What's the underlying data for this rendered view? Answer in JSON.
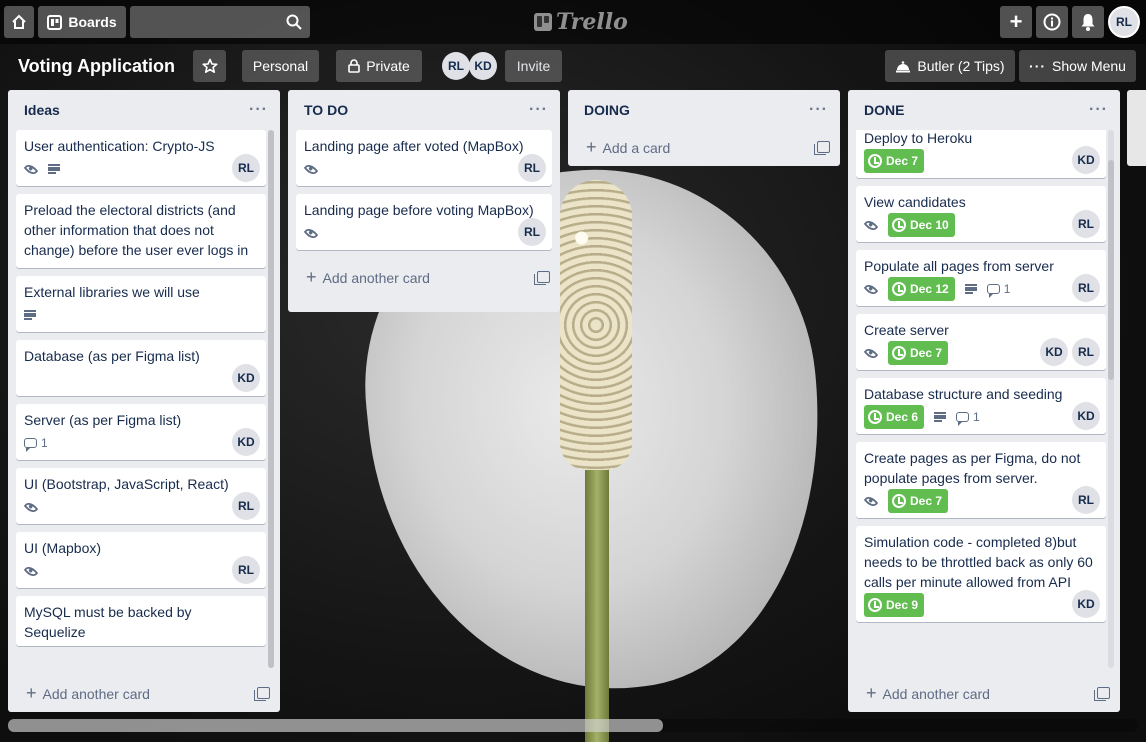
{
  "app": {
    "logo_text": "Trello"
  },
  "topbar": {
    "boards_label": "Boards",
    "search_value": "",
    "user_initials": "RL"
  },
  "board": {
    "title": "Voting Application",
    "team_label": "Personal",
    "visibility_label": "Private",
    "members": [
      "RL",
      "KD"
    ],
    "invite_label": "Invite",
    "butler_label": "Butler (2 Tips)",
    "menu_label": "Show Menu"
  },
  "add_card_label": "Add a card",
  "add_another_label": "Add another card",
  "colors": {
    "due_green": "#61bd4f",
    "list_bg": "#ebecf0"
  },
  "lists": [
    {
      "name": "Ideas",
      "cards": [
        {
          "title": "User authentication: Crypto-JS",
          "watch": true,
          "desc": true,
          "members": [
            "RL"
          ]
        },
        {
          "title": "Preload the electoral districts (and other information that does not change) before the user ever logs in",
          "members": []
        },
        {
          "title": "External libraries we will use",
          "desc": true,
          "members": []
        },
        {
          "title": "Database (as per Figma list)",
          "members": [
            "KD"
          ]
        },
        {
          "title": "Server (as per Figma list)",
          "comments": "1",
          "members": [
            "KD"
          ]
        },
        {
          "title": "UI (Bootstrap, JavaScript, React)",
          "watch": true,
          "members": [
            "RL"
          ]
        },
        {
          "title": "UI (Mapbox)",
          "watch": true,
          "members": [
            "RL"
          ]
        },
        {
          "title": "MySQL must be backed by Sequelize",
          "members": []
        }
      ]
    },
    {
      "name": "TO DO",
      "cards": [
        {
          "title": "Landing page after voted (MapBox)",
          "watch": true,
          "members": [
            "RL"
          ]
        },
        {
          "title": "Landing page before voting MapBox)",
          "watch": true,
          "members": [
            "RL"
          ]
        }
      ]
    },
    {
      "name": "DOING",
      "cards": []
    },
    {
      "name": "DONE",
      "cards": [
        {
          "title": "Deploy to Heroku",
          "due": "Dec 7",
          "members": [
            "KD"
          ]
        },
        {
          "title": "View candidates",
          "watch": true,
          "due": "Dec 10",
          "members": [
            "RL"
          ]
        },
        {
          "title": "Populate all pages from server",
          "watch": true,
          "due": "Dec 12",
          "desc": true,
          "comments": "1",
          "members": [
            "RL"
          ]
        },
        {
          "title": "Create server",
          "watch": true,
          "due": "Dec 7",
          "members": [
            "KD",
            "RL"
          ]
        },
        {
          "title": "Database structure and seeding",
          "due": "Dec 6",
          "desc": true,
          "comments": "1",
          "members": [
            "KD"
          ]
        },
        {
          "title": "Create pages as per Figma, do not populate pages from server.",
          "watch": true,
          "due": "Dec 7",
          "members": [
            "RL"
          ]
        },
        {
          "title": "Simulation code - completed 8)but needs to be throttled back as only 60 calls per minute allowed from API",
          "due": "Dec 9",
          "members": [
            "KD"
          ]
        }
      ]
    }
  ]
}
